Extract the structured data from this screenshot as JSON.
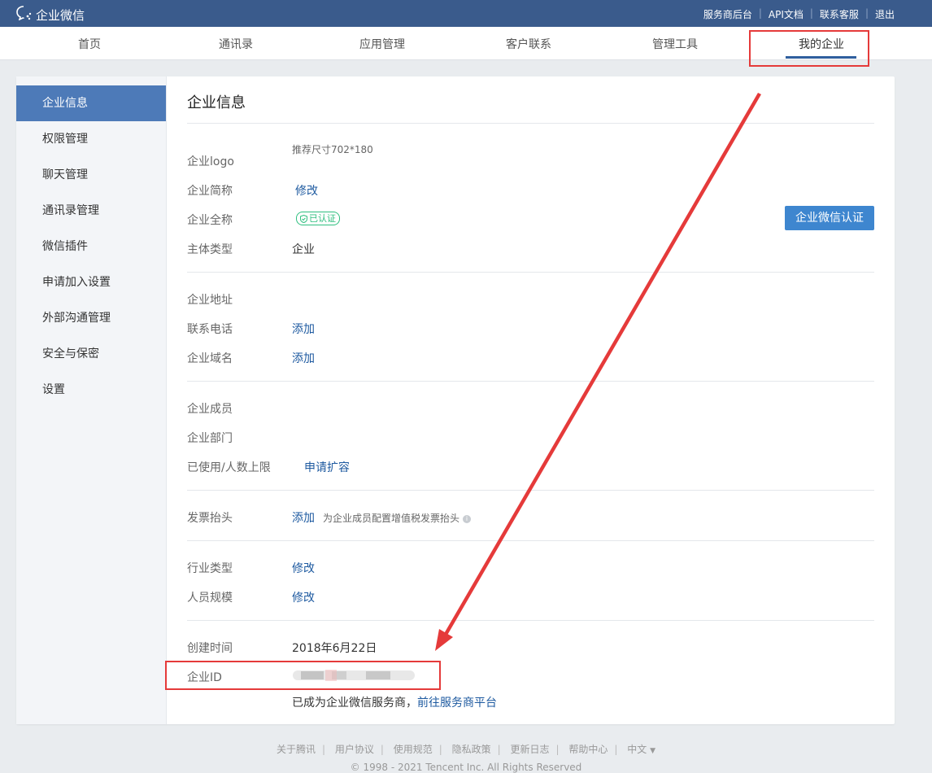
{
  "app": {
    "logo_text": "企业微信"
  },
  "top_links": [
    "服务商后台",
    "API文档",
    "联系客服",
    "退出"
  ],
  "nav_tabs": [
    {
      "label": "首页"
    },
    {
      "label": "通讯录"
    },
    {
      "label": "应用管理"
    },
    {
      "label": "客户联系"
    },
    {
      "label": "管理工具"
    },
    {
      "label": "我的企业",
      "active": true
    }
  ],
  "sidebar": {
    "items": [
      {
        "label": "企业信息",
        "active": true
      },
      {
        "label": "权限管理"
      },
      {
        "label": "聊天管理"
      },
      {
        "label": "通讯录管理"
      },
      {
        "label": "微信插件"
      },
      {
        "label": "申请加入设置"
      },
      {
        "label": "外部沟通管理"
      },
      {
        "label": "安全与保密"
      },
      {
        "label": "设置"
      }
    ]
  },
  "main": {
    "title": "企业信息",
    "logo_label": "企业logo",
    "logo_hint": "推荐尺寸702*180",
    "short_name_label": "企业简称",
    "short_name_action": "修改",
    "full_name_label": "企业全称",
    "verified_badge": "已认证",
    "verify_button": "企业微信认证",
    "entity_type_label": "主体类型",
    "entity_type_value": "企业",
    "address_label": "企业地址",
    "phone_label": "联系电话",
    "phone_action": "添加",
    "domain_label": "企业域名",
    "domain_action": "添加",
    "members_label": "企业成员",
    "departments_label": "企业部门",
    "usage_label": "已使用/人数上限",
    "usage_action": "申请扩容",
    "invoice_label": "发票抬头",
    "invoice_action": "添加",
    "invoice_hint": "为企业成员配置增值税发票抬头",
    "industry_label": "行业类型",
    "industry_action": "修改",
    "scale_label": "人员规模",
    "scale_action": "修改",
    "created_label": "创建时间",
    "created_value": "2018年6月22日",
    "corp_id_label": "企业ID",
    "provider_text": "已成为企业微信服务商，",
    "provider_link": "前往服务商平台"
  },
  "footer": {
    "links": [
      "关于腾讯",
      "用户协议",
      "使用规范",
      "隐私政策",
      "更新日志",
      "帮助中心"
    ],
    "language": "中文",
    "copyright": "© 1998 - 2021 Tencent Inc. All Rights Reserved"
  },
  "colors": {
    "topbar": "#3a5b8c",
    "sidebar_active": "#4d7ab8",
    "primary_button": "#3e86cf",
    "link": "#1e5aa0",
    "annotation_red": "#e53a3a",
    "verified_green": "#2ebf7f"
  }
}
